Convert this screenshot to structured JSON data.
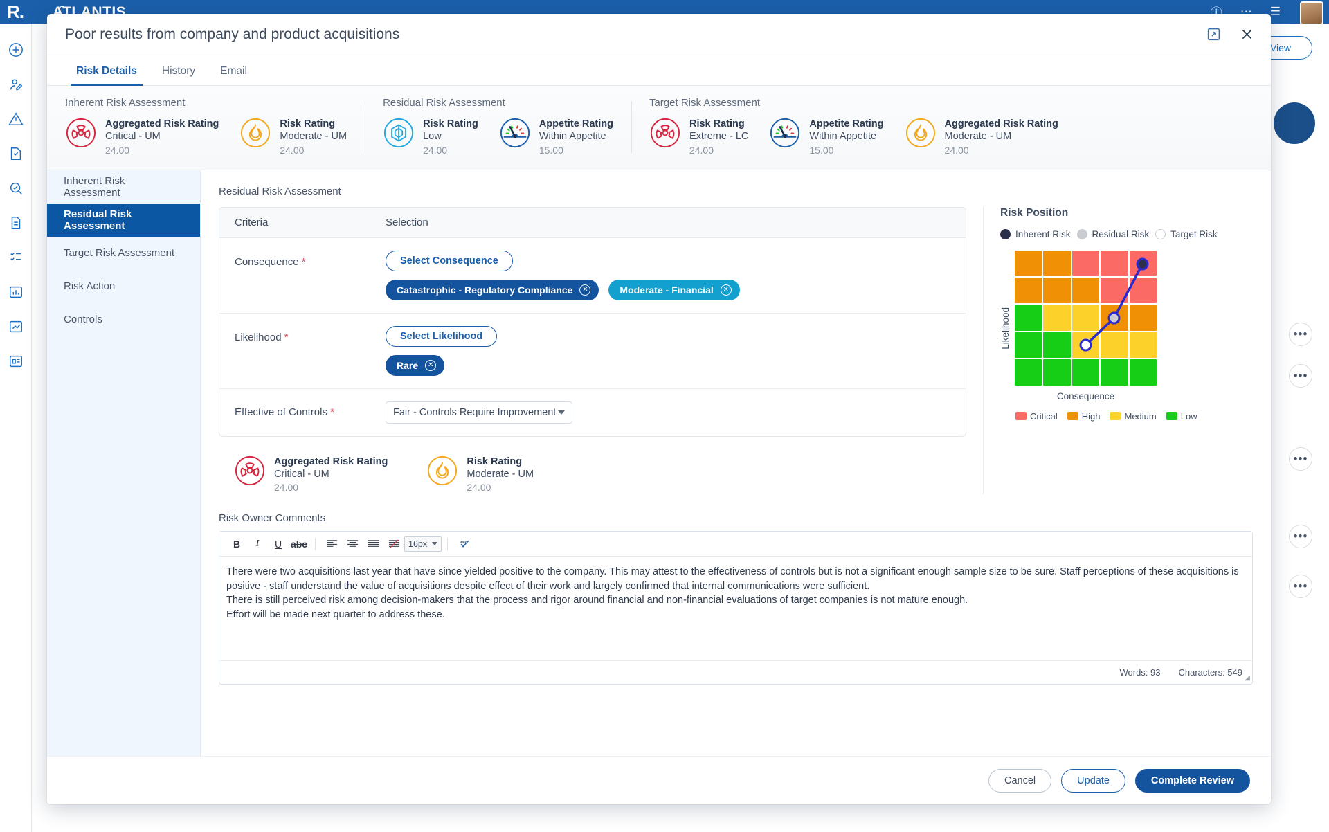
{
  "app": {
    "brand_mark": "R.",
    "brand_name": "ATLANTIS",
    "view_button": "View",
    "rail_icons": [
      "add-icon",
      "user-edit-icon",
      "warning-icon",
      "shield-doc-icon",
      "audit-icon",
      "report-icon",
      "checklist-icon",
      "dashboard-icon",
      "trend-icon",
      "register-icon"
    ],
    "row_menu": "•••"
  },
  "modal": {
    "title": "Poor results from company and product acquisitions",
    "expand_icon": "expand-icon",
    "close_icon": "close-icon",
    "tabs": [
      {
        "label": "Risk Details",
        "active": true
      },
      {
        "label": "History",
        "active": false
      },
      {
        "label": "Email",
        "active": false
      }
    ]
  },
  "summary": {
    "groups": [
      {
        "title": "Inherent Risk Assessment",
        "cards": [
          {
            "icon": "radiation-icon",
            "color": "#d7253f",
            "label": "Aggregated Risk Rating",
            "value": "Critical - UM",
            "score": "24.00"
          },
          {
            "icon": "flame-icon",
            "color": "#f5a71b",
            "label": "Risk Rating",
            "value": "Moderate - UM",
            "score": "24.00"
          }
        ]
      },
      {
        "title": "Residual Risk Assessment",
        "cards": [
          {
            "icon": "snowflake-icon",
            "color": "#21a7df",
            "label": "Risk Rating",
            "value": "Low",
            "score": "24.00"
          },
          {
            "icon": "gauge-icon",
            "color": "#1b5faa",
            "label": "Appetite Rating",
            "value": "Within Appetite",
            "score": "15.00"
          }
        ]
      },
      {
        "title": "Target Risk Assessment",
        "cards": [
          {
            "icon": "radiation-icon",
            "color": "#d7253f",
            "label": "Risk Rating",
            "value": "Extreme - LC",
            "score": "24.00"
          },
          {
            "icon": "gauge-icon",
            "color": "#1b5faa",
            "label": "Appetite Rating",
            "value": "Within Appetite",
            "score": "15.00"
          },
          {
            "icon": "flame-icon",
            "color": "#f5a71b",
            "label": "Aggregated Risk Rating",
            "value": "Moderate - UM",
            "score": "24.00"
          }
        ]
      }
    ]
  },
  "side_nav": {
    "items": [
      {
        "label": "Inherent Risk Assessment",
        "active": false
      },
      {
        "label": "Residual Risk Assessment",
        "active": true
      },
      {
        "label": "Target Risk Assessment",
        "active": false
      },
      {
        "label": "Risk Action",
        "active": false
      },
      {
        "label": "Controls",
        "active": false
      }
    ]
  },
  "main": {
    "section_title": "Residual Risk Assessment",
    "table": {
      "columns": [
        "Criteria",
        "Selection"
      ],
      "rows": [
        {
          "criteria": "Consequence",
          "required": true,
          "button": "Select Consequence",
          "chips": [
            {
              "label": "Catastrophic - Regulatory Compliance",
              "color": "#14539e"
            },
            {
              "label": "Moderate - Financial",
              "color": "#14a0ce"
            }
          ]
        },
        {
          "criteria": "Likelihood",
          "required": true,
          "button": "Select Likelihood",
          "chips": [
            {
              "label": "Rare",
              "color": "#14539e"
            }
          ]
        },
        {
          "criteria": "Effective of Controls",
          "required": true,
          "select_value": "Fair - Controls Require Improvement"
        }
      ]
    },
    "ratings": [
      {
        "icon": "radiation-icon",
        "color": "#d7253f",
        "label": "Aggregated Risk Rating",
        "value": "Critical - UM",
        "score": "24.00"
      },
      {
        "icon": "flame-icon",
        "color": "#f5a71b",
        "label": "Risk Rating",
        "value": "Moderate - UM",
        "score": "24.00"
      }
    ]
  },
  "risk_position": {
    "title": "Risk Position",
    "legend": [
      {
        "label": "Inherent Risk",
        "marker": "inherent"
      },
      {
        "label": "Residual Risk",
        "marker": "residual"
      },
      {
        "label": "Target Risk",
        "marker": "target"
      }
    ],
    "ylabel": "Likelihood",
    "xlabel": "Consequence",
    "key": [
      {
        "label": "Critical",
        "color": "#fb6a64"
      },
      {
        "label": "High",
        "color": "#ef9005"
      },
      {
        "label": "Medium",
        "color": "#fcd22a"
      },
      {
        "label": "Low",
        "color": "#16ce16"
      }
    ]
  },
  "chart_data": {
    "type": "heatmap",
    "title": "Risk Position",
    "xlabel": "Consequence",
    "ylabel": "Likelihood",
    "grid_size": [
      5,
      5
    ],
    "cell_colors": [
      [
        "#ef9005",
        "#ef9005",
        "#fb6a64",
        "#fb6a64",
        "#fb6a64"
      ],
      [
        "#ef9005",
        "#ef9005",
        "#ef9005",
        "#fb6a64",
        "#fb6a64"
      ],
      [
        "#16ce16",
        "#fcd22a",
        "#fcd22a",
        "#ef9005",
        "#ef9005"
      ],
      [
        "#16ce16",
        "#16ce16",
        "#fcd22a",
        "#fcd22a",
        "#fcd22a"
      ],
      [
        "#16ce16",
        "#16ce16",
        "#16ce16",
        "#16ce16",
        "#16ce16"
      ]
    ],
    "legend": [
      "Critical",
      "High",
      "Medium",
      "Low"
    ],
    "legend_colors": [
      "#fb6a64",
      "#ef9005",
      "#fcd22a",
      "#16ce16"
    ],
    "points": [
      {
        "name": "Target Risk",
        "col": 3,
        "row": 4,
        "fill": "#ffffff",
        "stroke": "#2a2ad0"
      },
      {
        "name": "Residual Risk",
        "col": 4,
        "row": 3,
        "fill": "#c9cdd2",
        "stroke": "#2a2ad0"
      },
      {
        "name": "Inherent Risk",
        "col": 5,
        "row": 1,
        "fill": "#2c2f4a",
        "stroke": "#2a2ad0"
      }
    ],
    "connector": "line"
  },
  "comments": {
    "title": "Risk Owner Comments",
    "toolbar": {
      "bold": "B",
      "italic": "I",
      "underline": "U",
      "strike": "abc",
      "align_left": "align-left-icon",
      "align_center": "align-center-icon",
      "align_justify": "align-justify-icon",
      "align_remove": "remove-format-icon",
      "font_size": "16px",
      "spellcheck": "ABC"
    },
    "paragraphs": [
      "There were two acquisitions last year that have since yielded positive to the company. This may attest to the effectiveness of controls but is not a significant enough sample size to be sure. Staff perceptions of these acquisitions is positive - staff understand the value of acquisitions despite effect of their work and largely confirmed that internal communications were sufficient.",
      "There is still perceived risk among decision-makers that the process and rigor around financial and non-financial evaluations of target companies is not mature enough.",
      "Effort will be made next quarter to address these."
    ],
    "words": "Words: 93",
    "characters": "Characters: 549"
  },
  "footer": {
    "cancel": "Cancel",
    "update": "Update",
    "complete": "Complete Review"
  }
}
